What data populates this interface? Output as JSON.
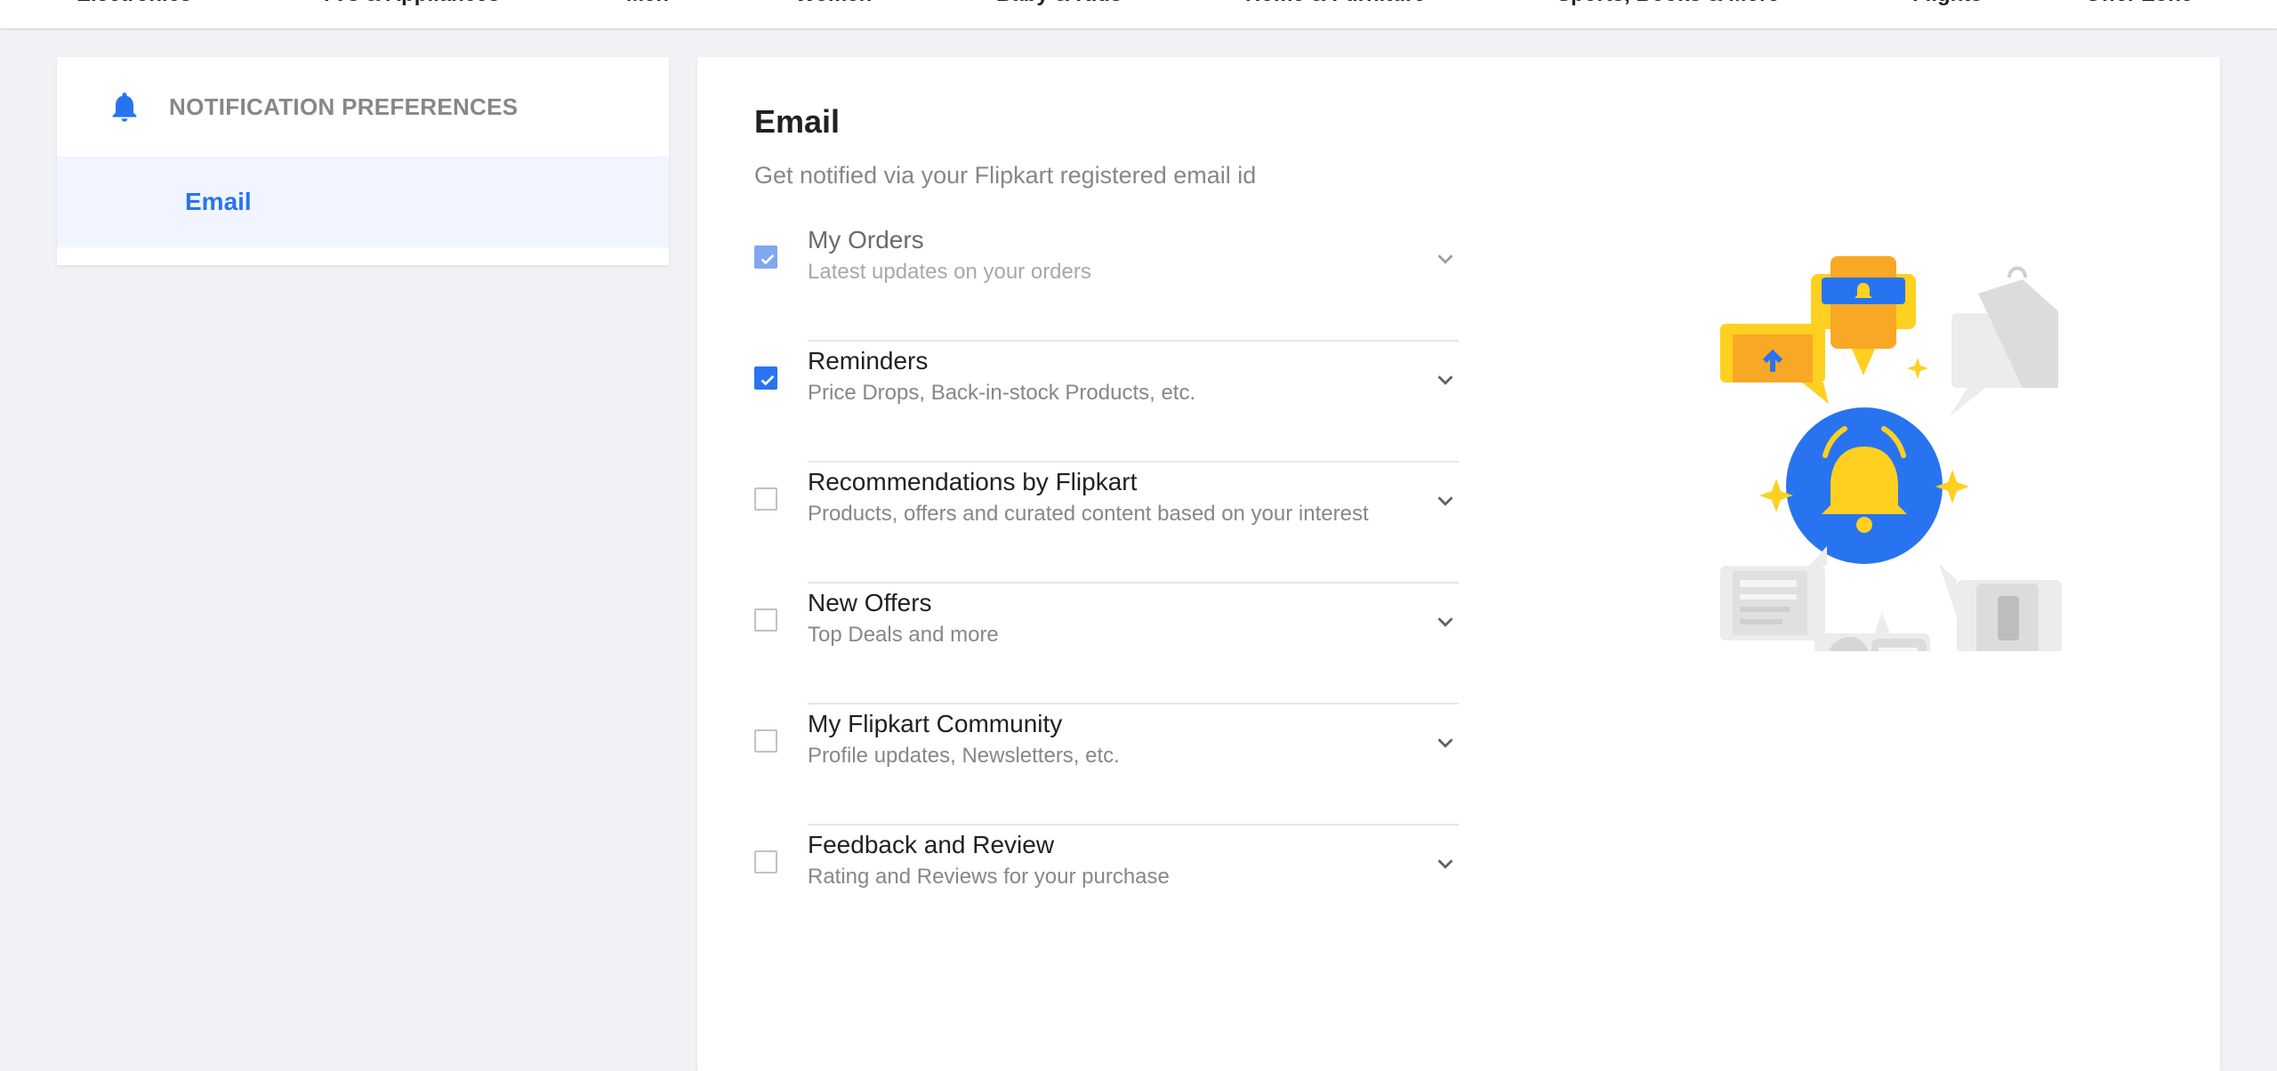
{
  "topnav": {
    "items": [
      "Electronics",
      "TVs & Appliances",
      "Men",
      "Women",
      "Baby & Kids",
      "Home & Furniture",
      "Sports, Books & More",
      "Flights",
      "Offer Zone"
    ]
  },
  "sidebar": {
    "title": "NOTIFICATION PREFERENCES",
    "items": [
      {
        "label": "Email",
        "selected": true
      }
    ]
  },
  "main": {
    "title": "Email",
    "subtitle": "Get notified via your Flipkart registered email id",
    "preferences": [
      {
        "title": "My Orders",
        "description": "Latest updates on your orders",
        "checked": true,
        "disabled": true
      },
      {
        "title": "Reminders",
        "description": "Price Drops, Back-in-stock Products, etc.",
        "checked": true,
        "disabled": false
      },
      {
        "title": "Recommendations by Flipkart",
        "description": "Products, offers and curated content based on your interest",
        "checked": false,
        "disabled": false
      },
      {
        "title": "New Offers",
        "description": "Top Deals and more",
        "checked": false,
        "disabled": false
      },
      {
        "title": "My Flipkart Community",
        "description": "Profile updates, Newsletters, etc.",
        "checked": false,
        "disabled": false
      },
      {
        "title": "Feedback and Review",
        "description": "Rating and Reviews for your purchase",
        "checked": false,
        "disabled": false
      }
    ]
  },
  "colors": {
    "accent": "#2874f0",
    "bell_yellow": "#ffd01f",
    "background": "#f1f2f6"
  }
}
